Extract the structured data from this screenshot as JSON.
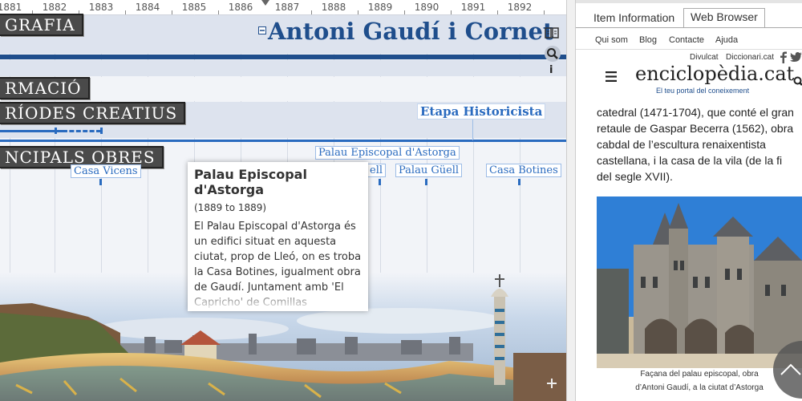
{
  "timeline": {
    "years": [
      "1881",
      "1882",
      "1883",
      "1884",
      "1885",
      "1886",
      "1887",
      "1888",
      "1889",
      "1890",
      "1891",
      "1892"
    ],
    "title": "Antoni Gaudí i Cornet",
    "categories": {
      "biografia": "GRAFIA",
      "formacio": "RMACIÓ",
      "periodes": "RÍODES CREATIUS",
      "obres": "NCIPALS OBRES"
    },
    "era_label": "Etapa Historicista",
    "events": {
      "palau_astorga_top": "Palau Episcopal d'Astorga",
      "casa_vicens": "Casa Vicens",
      "palau_guell_partial": "ell",
      "palau_guell": "Palau Güell",
      "casa_botines": "Casa Botines"
    },
    "tooltip": {
      "title": "Palau Episcopal d'Astorga",
      "dates": "(1889 to 1889)",
      "description": "El Palau Episcopal d'Astorga és un edifici situat en aquesta ciutat, prop de Lleó, on es troba la Casa Botines, igualment obra de Gaudí. Juntament amb 'El Capricho' de Comillas (Cantàbria), són les úniques obres de Gaudí fora de"
    },
    "tools": {
      "info": "i"
    }
  },
  "panel": {
    "tabs": {
      "item_info": "Item Information",
      "web_browser": "Web Browser"
    },
    "site_nav": {
      "qui_som": "Qui som",
      "blog": "Blog",
      "contacte": "Contacte",
      "ajuda": "Ajuda"
    },
    "sub_links": {
      "divulcat": "Divulcat",
      "diccionari": "Diccionari.cat"
    },
    "logo": "enciclopèdia.cat",
    "tagline": "El teu portal del coneixement",
    "body": "catedral (1471-1704), que conté el gran retaule de Gaspar Becerra (1562), obra cabdal de l’escultura renaixentista castellana, i la casa de la vila (de la fi del segle XVII).",
    "caption_line1": "Façana del palau episcopal, obra",
    "caption_line2": "d’Antoni Gaudí, a la ciutat d’Astorga"
  },
  "colors": {
    "accent": "#2a6bbf",
    "title": "#1f4e8c",
    "category_bg": "#4a4a4a",
    "band_light": "#dde3ee"
  }
}
